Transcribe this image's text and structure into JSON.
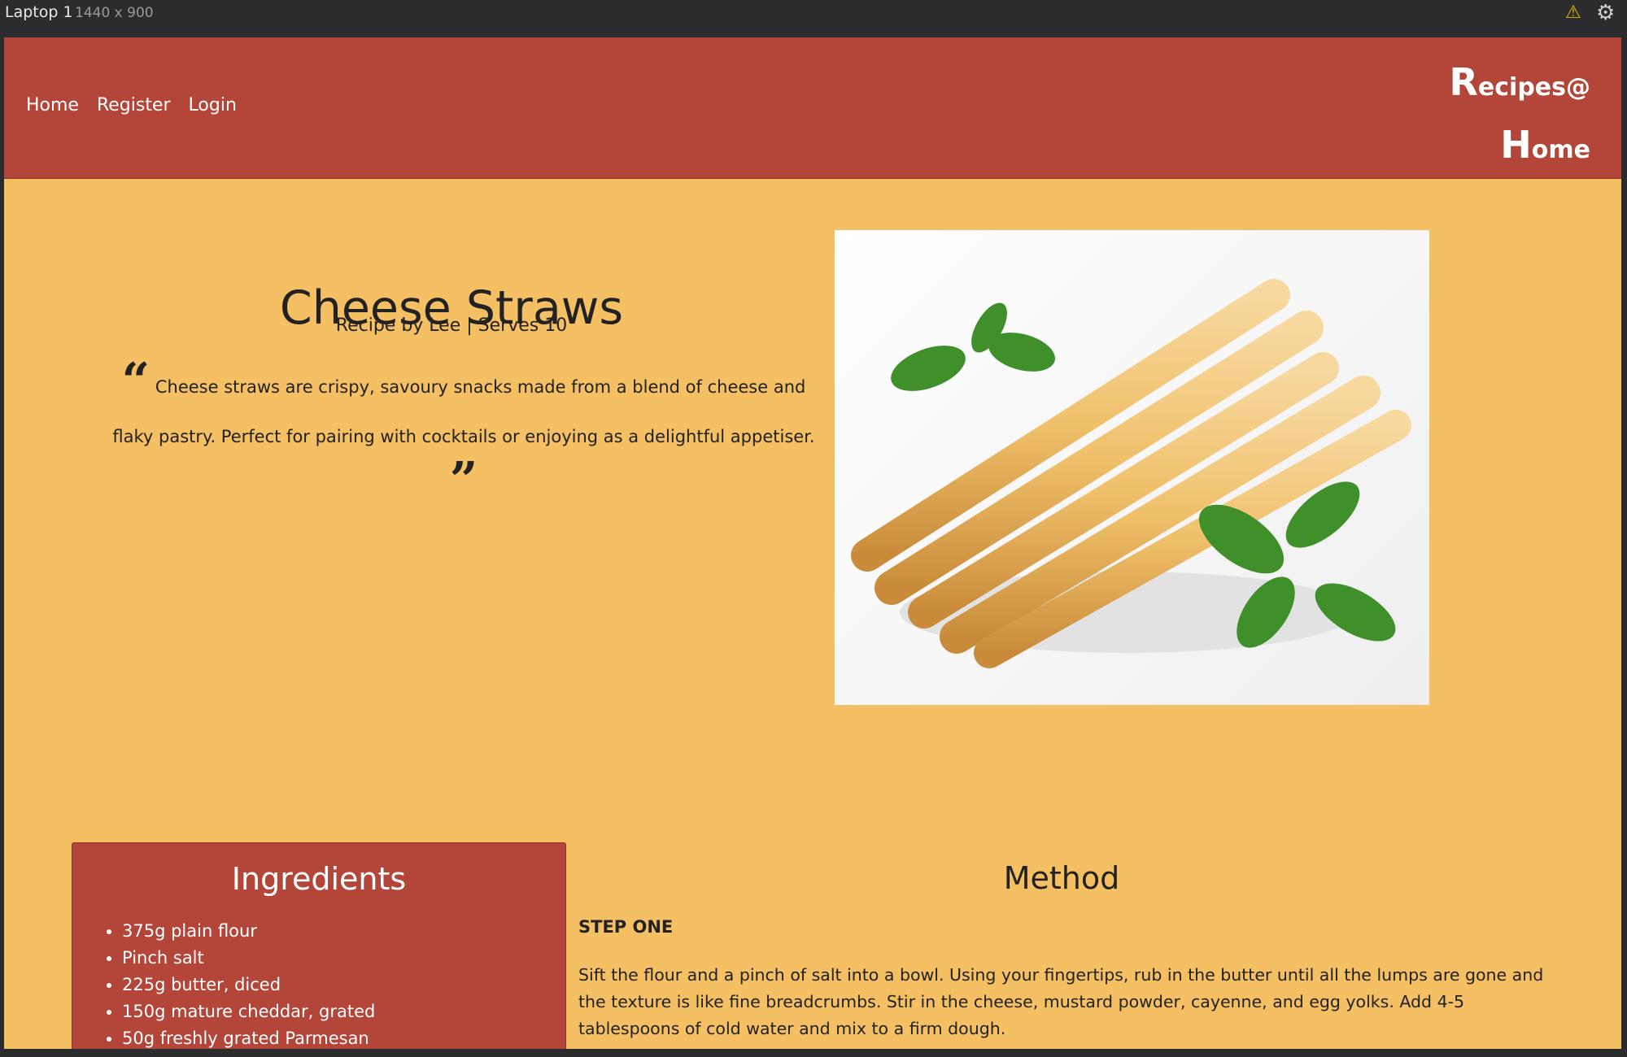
{
  "window": {
    "device_name": "Laptop 1",
    "viewport_size": "1440 x 900"
  },
  "nav": {
    "items": [
      "Home",
      "Register",
      "Login"
    ]
  },
  "brand": {
    "line1_big": "R",
    "line1_small": "ecipes@",
    "line2_big": "H",
    "line2_small": "ome"
  },
  "recipe": {
    "title": "Cheese Straws",
    "byline": "Recipe by Lee | Serves 10",
    "description": "Cheese straws are crispy, savoury snacks made from a blend of cheese and flaky pastry. Perfect for pairing with cocktails or enjoying as a delightful appetiser.",
    "quote_open": "“",
    "quote_close": "”"
  },
  "ingredients": {
    "title": "Ingredients",
    "items": [
      "375g plain flour",
      "Pinch salt",
      "225g butter, diced",
      "150g mature cheddar, grated",
      "50g freshly grated Parmesan"
    ]
  },
  "method": {
    "title": "Method",
    "step_label": "STEP ONE",
    "step_text": "Sift the flour and a pinch of salt into a bowl. Using your fingertips, rub in the butter until all the lumps are gone and the texture is like fine breadcrumbs. Stir in the cheese, mustard powder, cayenne, and egg yolks. Add 4-5 tablespoons of cold water and mix to a firm dough."
  },
  "colors": {
    "header": "#b34539",
    "page": "#f5bf63",
    "text": "#222222"
  },
  "icons": {
    "warning": "warning-icon",
    "settings": "gear-icon"
  }
}
